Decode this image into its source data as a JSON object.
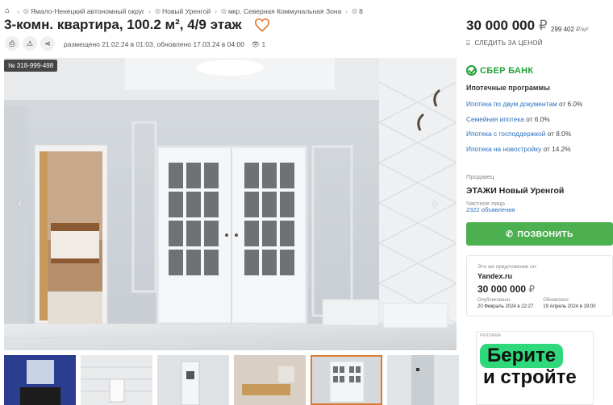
{
  "breadcrumbs": [
    "Ямало-Ненецкий автономный округ",
    "Новый Уренгой",
    "мкр. Северная Коммунальная Зона",
    "8"
  ],
  "listing": {
    "title": "3-комн. квартира, 100.2 м², 4/9 этаж",
    "meta": "размещено 21.02.24 в 01:03, обновлено 17.03.24 в 04:00",
    "views": "1",
    "id_badge": "№ 318-999-498"
  },
  "price": {
    "amount": "30 000 000",
    "currency": "₽",
    "per_sqm": "299 402",
    "per_sqm_unit": "₽/м²",
    "follow_label": "СЛЕДИТЬ ЗА ЦЕНОЙ"
  },
  "bank": {
    "name": "СБЕР БАНК",
    "heading": "Ипотечные программы",
    "programs": [
      {
        "link": "Ипотека по двум документам",
        "rate": " от 6.0%"
      },
      {
        "link": "Семейная ипотека",
        "rate": " от 6.0%"
      },
      {
        "link": "Ипотека с господдержкой",
        "rate": " от 8.0%"
      },
      {
        "link": "Ипотека на новостройку",
        "rate": " от 14.2%"
      }
    ]
  },
  "seller": {
    "label": "Продавец",
    "name": "ЭТАЖИ Новый Уренгой",
    "type": "Частное лицо",
    "count": "2322 объявления"
  },
  "call_button": "ПОЗВОНИТЬ",
  "alt_offer": {
    "note": "Это же предложение on:",
    "site": "Yandex.ru",
    "price": "30 000 000",
    "currency": "₽",
    "published_label": "Опубликовано:",
    "published": "20 Февраль 2024 в 22:27",
    "updated_label": "Обновлено:",
    "updated": "19 Апрель 2024 в 19:00"
  },
  "ad": {
    "label": "РЕКЛАМА",
    "line1": "Берите",
    "line2": "и стройте"
  },
  "colors": {
    "accent_green": "#4caf50",
    "sber_green": "#21a038",
    "link_blue": "#2a6fbf",
    "thumb_active": "#e07a2e"
  }
}
